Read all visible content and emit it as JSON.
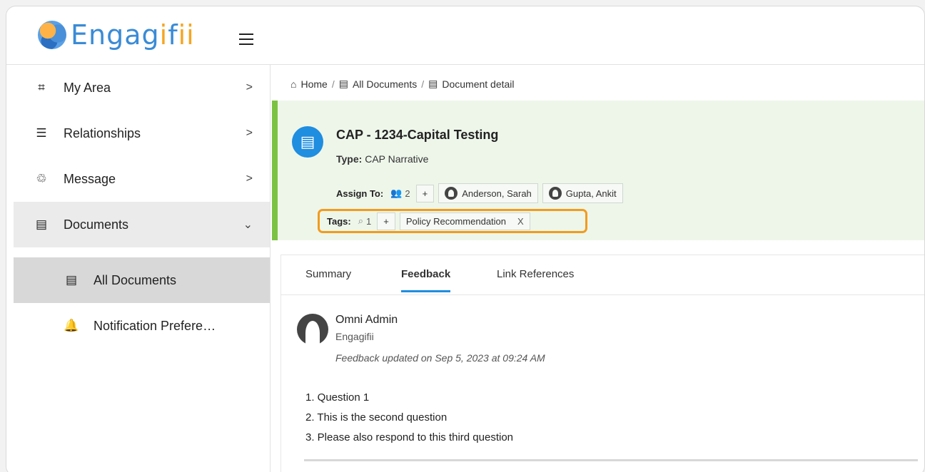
{
  "app": {
    "logo_text_prefix": "Engag",
    "logo_text_accent": "i",
    "logo_text_mid": "f",
    "logo_text_suffix": "ii"
  },
  "sidebar": {
    "items": [
      {
        "label": "My Area",
        "icon": "focus-icon",
        "chevron": ">"
      },
      {
        "label": "Relationships",
        "icon": "server-icon",
        "chevron": ">"
      },
      {
        "label": "Message",
        "icon": "recycle-icon",
        "chevron": ">"
      },
      {
        "label": "Documents",
        "icon": "document-icon",
        "chevron": "⌄"
      }
    ],
    "subitems": [
      {
        "label": "All Documents",
        "icon": "document-icon"
      },
      {
        "label": "Notification Prefere…",
        "icon": "bell-icon"
      }
    ]
  },
  "breadcrumb": {
    "home": "Home",
    "sep": "/",
    "all_documents": "All Documents",
    "current": "Document detail"
  },
  "document": {
    "title": "CAP - 1234-Capital Testing",
    "type_label": "Type:",
    "type_value": "CAP Narrative",
    "assign_label": "Assign To:",
    "assign_count": "2",
    "add": "+",
    "assignees": [
      "Anderson, Sarah",
      "Gupta, Ankit"
    ],
    "tags_label": "Tags:",
    "tags_count": "1",
    "tags": [
      {
        "label": "Policy Recommendation",
        "remove": "X"
      }
    ]
  },
  "tabs": [
    "Summary",
    "Feedback",
    "Link References"
  ],
  "feedback": {
    "author": "Omni Admin",
    "org": "Engagifii",
    "updated": "Feedback updated on Sep 5, 2023 at 09:24 AM",
    "items": [
      "1. Question 1",
      "2. This is the second question",
      "3. Please also respond to this third question"
    ]
  },
  "colors": {
    "accent_blue": "#1f8de0",
    "highlight_orange": "#f29b1d",
    "header_green": "#7cc242"
  }
}
